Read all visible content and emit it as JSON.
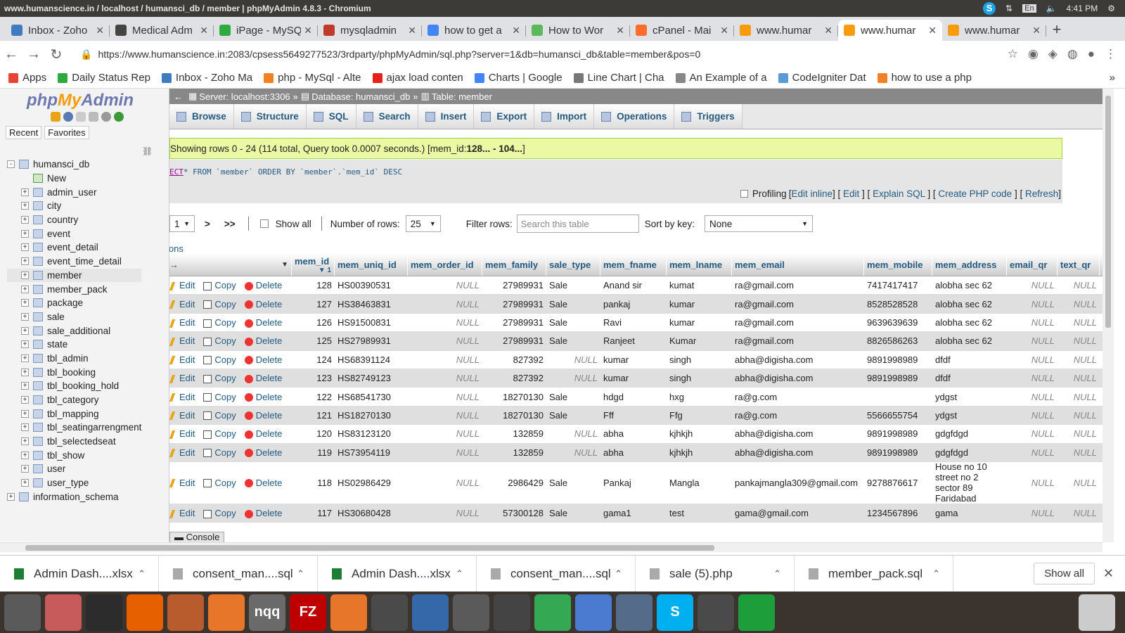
{
  "os": {
    "window_title": "www.humanscience.in / localhost / humansci_db / member | phpMyAdmin 4.8.3 - Chromium",
    "lang": "En",
    "clock": "4:41 PM"
  },
  "browser": {
    "tabs": [
      {
        "label": "Inbox - Zoho",
        "color": "#3f7bbf"
      },
      {
        "label": "Medical Adm",
        "color": "#444444"
      },
      {
        "label": "iPage - MySQ",
        "color": "#2eaa3f"
      },
      {
        "label": "mysqladmin",
        "color": "#c0392b"
      },
      {
        "label": "how to get a",
        "color": "#4285f4"
      },
      {
        "label": "How to Wor",
        "color": "#5cb85c"
      },
      {
        "label": "cPanel - Mai",
        "color": "#ff6c2c"
      },
      {
        "label": "www.humar",
        "color": "#f89c0e"
      },
      {
        "label": "www.humar",
        "color": "#f89c0e",
        "active": true
      },
      {
        "label": "www.humar",
        "color": "#f89c0e"
      }
    ],
    "url": "https://www.humanscience.in:2083/cpsess5649277523/3rdparty/phpMyAdmin/sql.php?server=1&db=humansci_db&table=member&pos=0",
    "bookmarks": [
      {
        "label": "Apps",
        "color": "#e94335"
      },
      {
        "label": "Daily Status Rep",
        "color": "#2eaa3f"
      },
      {
        "label": "Inbox - Zoho Ma",
        "color": "#3f7bbf"
      },
      {
        "label": "php - MySql - Alte",
        "color": "#f48024"
      },
      {
        "label": "ajax load conten",
        "color": "#e62117"
      },
      {
        "label": "Charts | Google",
        "color": "#4285f4"
      },
      {
        "label": "Line Chart | Cha",
        "color": "#777777"
      },
      {
        "label": "An Example of a",
        "color": "#888888"
      },
      {
        "label": "CodeIgniter Dat",
        "color": "#5b9bd5"
      },
      {
        "label": "how to use a php",
        "color": "#f48024"
      }
    ]
  },
  "sidebar": {
    "logo_php": "php",
    "logo_my": "My",
    "logo_admin": "Admin",
    "recent": "Recent",
    "favorites": "Favorites",
    "db": "humansci_db",
    "new": "New",
    "tables": [
      "admin_user",
      "city",
      "country",
      "event",
      "event_detail",
      "event_time_detail",
      "member",
      "member_pack",
      "package",
      "sale",
      "sale_additional",
      "state",
      "tbl_admin",
      "tbl_booking",
      "tbl_booking_hold",
      "tbl_category",
      "tbl_mapping",
      "tbl_seatingarrengment",
      "tbl_selectedseat",
      "tbl_show",
      "user",
      "user_type"
    ],
    "selected": "member",
    "other_db": "information_schema"
  },
  "main": {
    "breadcrumb": {
      "server": "Server: localhost:3306",
      "database": "Database: humansci_db",
      "table": "Table: member"
    },
    "tabs": [
      "Browse",
      "Structure",
      "SQL",
      "Search",
      "Insert",
      "Export",
      "Import",
      "Operations",
      "Triggers"
    ],
    "message": "Showing rows 0 - 24 (114 total, Query took 0.0007 seconds.) [mem_id: ",
    "message_bold": "128... - 104...",
    "message_end": "]",
    "sql_partial": "ECT",
    "sql_rest": " * FROM `member` ORDER BY `member`.`mem_id` DESC",
    "profiling": "Profiling",
    "links": [
      "Edit inline",
      "Edit",
      "Explain SQL",
      "Create PHP code",
      "Refresh"
    ],
    "pager": {
      "page": "1",
      "next": ">",
      "last": ">>",
      "show_all": "Show all",
      "rows_label": "Number of rows:",
      "rows_value": "25",
      "filter_label": "Filter rows:",
      "filter_placeholder": "Search this table",
      "sort_label": "Sort by key:",
      "sort_value": "None"
    },
    "options_link": "ions",
    "columns": [
      "mem_id",
      "mem_uniq_id",
      "mem_order_id",
      "mem_family",
      "sale_type",
      "mem_fname",
      "mem_lname",
      "mem_email",
      "mem_mobile",
      "mem_address",
      "email_qr",
      "text_qr"
    ],
    "sort_indicator": "1",
    "actions": {
      "edit": "Edit",
      "copy": "Copy",
      "delete": "Delete"
    },
    "rows": [
      [
        "128",
        "HS00390531",
        "NULL",
        "27989931",
        "Sale",
        "Anand sir",
        "kumat",
        "ra@gmail.com",
        "7417417417",
        "alobha sec 62",
        "NULL",
        "NULL"
      ],
      [
        "127",
        "HS38463831",
        "NULL",
        "27989931",
        "Sale",
        "pankaj",
        "kumar",
        "ra@gmail.com",
        "8528528528",
        "alobha sec 62",
        "NULL",
        "NULL"
      ],
      [
        "126",
        "HS91500831",
        "NULL",
        "27989931",
        "Sale",
        "Ravi",
        "kumar",
        "ra@gmail.com",
        "9639639639",
        "alobha sec 62",
        "NULL",
        "NULL"
      ],
      [
        "125",
        "HS27989931",
        "NULL",
        "27989931",
        "Sale",
        "Ranjeet",
        "Kumar",
        "ra@gmail.com",
        "8826586263",
        "alobha sec 62",
        "NULL",
        "NULL"
      ],
      [
        "124",
        "HS68391124",
        "NULL",
        "827392",
        "NULL",
        "kumar",
        "singh",
        "abha@digisha.com",
        "9891998989",
        "dfdf",
        "NULL",
        "NULL"
      ],
      [
        "123",
        "HS82749123",
        "NULL",
        "827392",
        "NULL",
        "kumar",
        "singh",
        "abha@digisha.com",
        "9891998989",
        "dfdf",
        "NULL",
        "NULL"
      ],
      [
        "122",
        "HS68541730",
        "NULL",
        "18270130",
        "Sale",
        "hdgd",
        "hxg",
        "ra@g.com",
        "",
        "ydgst",
        "NULL",
        "NULL"
      ],
      [
        "121",
        "HS18270130",
        "NULL",
        "18270130",
        "Sale",
        "Fff",
        "Ffg",
        "ra@g.com",
        "5566655754",
        "ydgst",
        "NULL",
        "NULL"
      ],
      [
        "120",
        "HS83123120",
        "NULL",
        "132859",
        "NULL",
        "abha",
        "kjhkjh",
        "abha@digisha.com",
        "9891998989",
        "gdgfdgd",
        "NULL",
        "NULL"
      ],
      [
        "119",
        "HS73954119",
        "NULL",
        "132859",
        "NULL",
        "abha",
        "kjhkjh",
        "abha@digisha.com",
        "9891998989",
        "gdgfdgd",
        "NULL",
        "NULL"
      ],
      [
        "118",
        "HS02986429",
        "NULL",
        "2986429",
        "Sale",
        "Pankaj",
        "Mangla",
        "pankajmangla309@gmail.com",
        "9278876617",
        "House no 10 street no 2 sector 89 Faridabad",
        "NULL",
        "NULL"
      ],
      [
        "117",
        "HS30680428",
        "NULL",
        "57300128",
        "Sale",
        "gama1",
        "test",
        "gama@gmail.com",
        "1234567896",
        "gama",
        "NULL",
        "NULL"
      ]
    ],
    "console": "Console"
  },
  "downloads": {
    "items": [
      {
        "label": "Admin Dash....xlsx",
        "color": "#1e7e34"
      },
      {
        "label": "consent_man....sql",
        "color": "#aaaaaa"
      },
      {
        "label": "Admin Dash....xlsx",
        "color": "#1e7e34"
      },
      {
        "label": "consent_man....sql",
        "color": "#aaaaaa"
      },
      {
        "label": "sale (5).php",
        "color": "#aaaaaa"
      },
      {
        "label": "member_pack.sql",
        "color": "#aaaaaa"
      }
    ],
    "show_all": "Show all"
  },
  "dock": [
    {
      "name": "ubuntu-icon",
      "color": "#5a5a5a"
    },
    {
      "name": "files-icon",
      "color": "#c75a5a"
    },
    {
      "name": "terminal-icon",
      "color": "#2c2c2c"
    },
    {
      "name": "firefox-icon",
      "color": "#e66000"
    },
    {
      "name": "document-viewer-icon",
      "color": "#b85c2e"
    },
    {
      "name": "software-center-icon",
      "color": "#e8762a"
    },
    {
      "name": "nqq-icon",
      "color": "#6a6a6a",
      "text": "nqq"
    },
    {
      "name": "filezilla-icon",
      "color": "#bf0000",
      "text": "FZ"
    },
    {
      "name": "pen-icon",
      "color": "#e8762a"
    },
    {
      "name": "editor-icon",
      "color": "#4a4a4a"
    },
    {
      "name": "network-icon",
      "color": "#3468a8"
    },
    {
      "name": "calculator-icon",
      "color": "#5a5a5a"
    },
    {
      "name": "inkscape-icon",
      "color": "#444444"
    },
    {
      "name": "chrome-icon",
      "color": "#34a853"
    },
    {
      "name": "chromium-icon",
      "color": "#4a7bd1"
    },
    {
      "name": "screenshot-icon",
      "color": "#556b8a"
    },
    {
      "name": "skype-icon",
      "color": "#00aff0",
      "text": "S"
    },
    {
      "name": "sublime-icon",
      "color": "#4a4a4a"
    },
    {
      "name": "spreadsheet-icon",
      "color": "#1e9e3a"
    }
  ]
}
